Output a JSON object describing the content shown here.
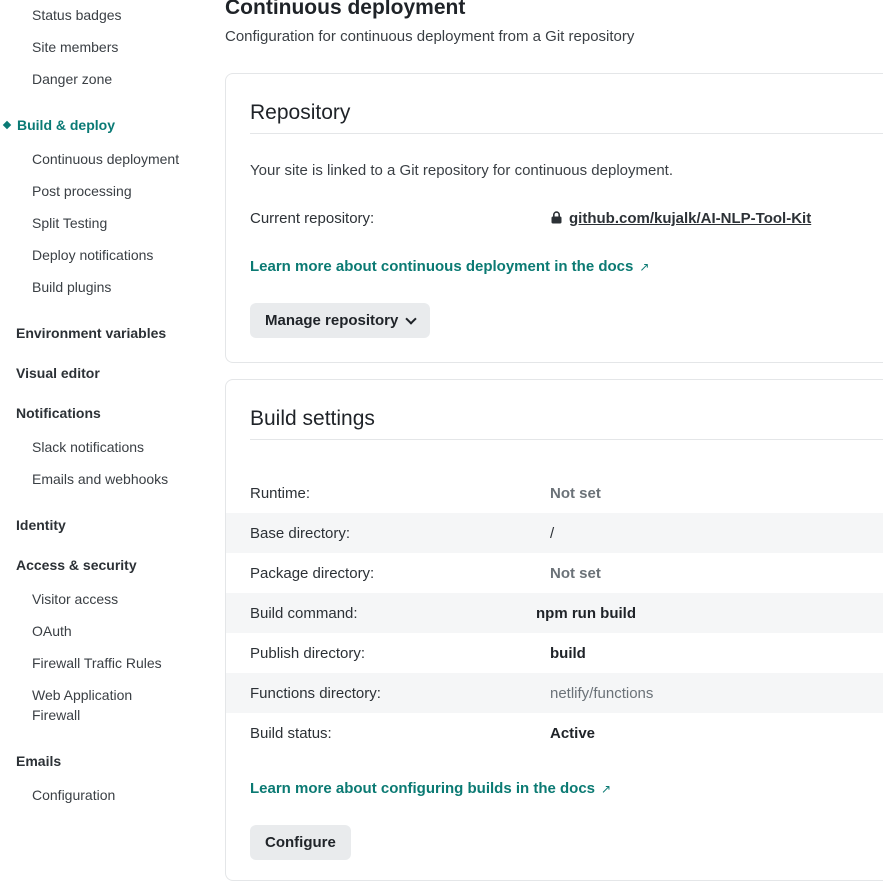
{
  "sidebar": {
    "items": [
      {
        "label": "Status badges"
      },
      {
        "label": "Site members"
      },
      {
        "label": "Danger zone"
      }
    ],
    "build_deploy": {
      "label": "Build & deploy",
      "items": [
        {
          "label": "Continuous deployment"
        },
        {
          "label": "Post processing"
        },
        {
          "label": "Split Testing"
        },
        {
          "label": "Deploy notifications"
        },
        {
          "label": "Build plugins"
        }
      ]
    },
    "environment_variables": "Environment variables",
    "visual_editor": "Visual editor",
    "notifications": {
      "label": "Notifications",
      "items": [
        {
          "label": "Slack notifications"
        },
        {
          "label": "Emails and webhooks"
        }
      ]
    },
    "identity": "Identity",
    "access_security": {
      "label": "Access & security",
      "items": [
        {
          "label": "Visitor access"
        },
        {
          "label": "OAuth"
        },
        {
          "label": "Firewall Traffic Rules"
        },
        {
          "label": "Web Application Firewall"
        }
      ]
    },
    "emails": {
      "label": "Emails",
      "items": [
        {
          "label": "Configuration"
        }
      ]
    }
  },
  "main": {
    "title": "Continuous deployment",
    "subtitle": "Configuration for continuous deployment from a Git repository"
  },
  "repository": {
    "title": "Repository",
    "description": "Your site is linked to a Git repository for continuous deployment.",
    "current_label": "Current repository:",
    "current_value": "github.com/kujalk/AI-NLP-Tool-Kit",
    "docs_link": "Learn more about continuous deployment in the docs",
    "manage_button": "Manage repository"
  },
  "build_settings": {
    "title": "Build settings",
    "rows": [
      {
        "label": "Runtime:",
        "value": "Not set"
      },
      {
        "label": "Base directory:",
        "value": "/"
      },
      {
        "label": "Package directory:",
        "value": "Not set"
      },
      {
        "label": "Build command:",
        "value": "npm run build"
      },
      {
        "label": "Publish directory:",
        "value": "build"
      },
      {
        "label": "Functions directory:",
        "value": "netlify/functions"
      },
      {
        "label": "Build status:",
        "value": "Active"
      }
    ],
    "docs_link": "Learn more about configuring builds in the docs",
    "configure_button": "Configure"
  },
  "colors": {
    "accent": "#0a7a75",
    "muted_value": "#6b7278",
    "button_bg": "#e9ebed",
    "alt_row_bg": "#f5f6f7"
  }
}
